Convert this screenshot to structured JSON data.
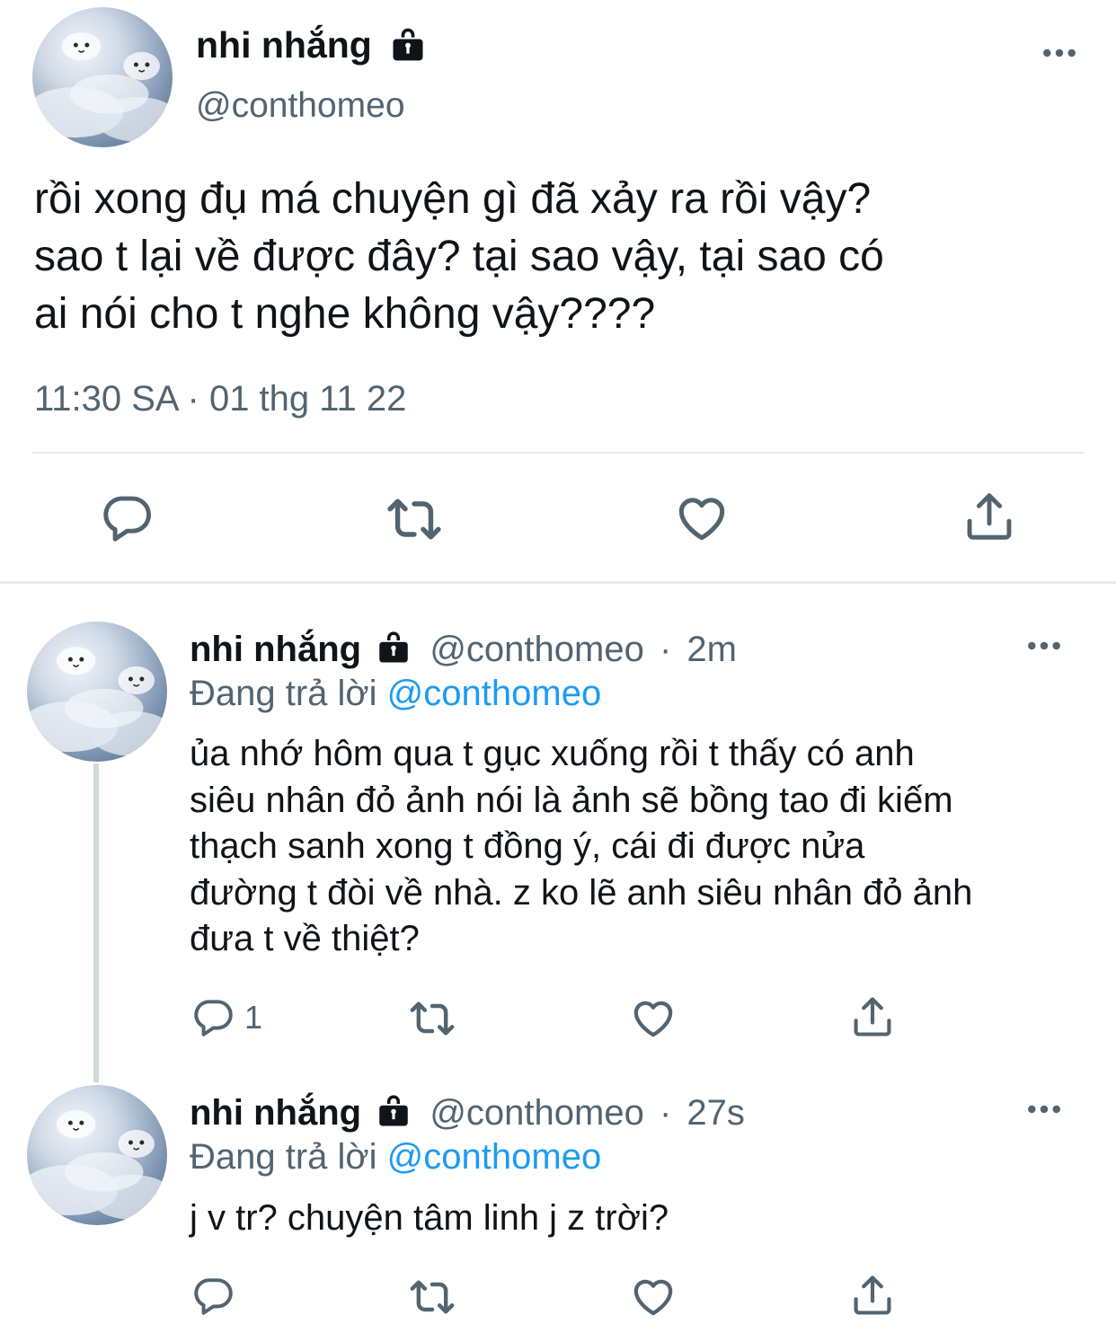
{
  "main_tweet": {
    "display_name": "nhi nhắng",
    "handle": "@conthomeo",
    "text_lines": [
      "rồi xong đụ má chuyện gì đã xảy ra rồi vậy?",
      "sao t lại về được đây? tại sao vậy, tại sao có",
      "ai nói cho t nghe không vậy????"
    ],
    "timestamp": "11:30 SA · 01 thg 11 22",
    "actions": [
      "reply-icon",
      "retweet-icon",
      "like-icon",
      "share-icon"
    ]
  },
  "replies": [
    {
      "display_name": "nhi nhắng",
      "handle": "@conthomeo",
      "dot": "·",
      "time": "2m",
      "replying_prefix": "Đang trả lời",
      "replying_to": "@conthomeo",
      "text_lines": [
        "ủa nhớ hôm qua t gục xuống rồi t thấy có anh",
        "siêu nhân đỏ ảnh nói là ảnh sẽ bồng tao đi kiếm",
        "thạch sanh xong t đồng ý, cái đi được nửa",
        "đường t đòi về nhà. z ko lẽ anh siêu nhân đỏ ảnh",
        "đưa t về thiệt?"
      ],
      "reply_count": "1"
    },
    {
      "display_name": "nhi nhắng",
      "handle": "@conthomeo",
      "dot": "·",
      "time": "27s",
      "replying_prefix": "Đang trả lời",
      "replying_to": "@conthomeo",
      "text_lines": [
        "j v tr? chuyện tâm linh j z trời?"
      ],
      "reply_count": ""
    }
  ],
  "colors": {
    "text": "#0f1419",
    "secondary": "#536471",
    "link": "#1d9bf0",
    "divider": "#e6e9eb"
  }
}
